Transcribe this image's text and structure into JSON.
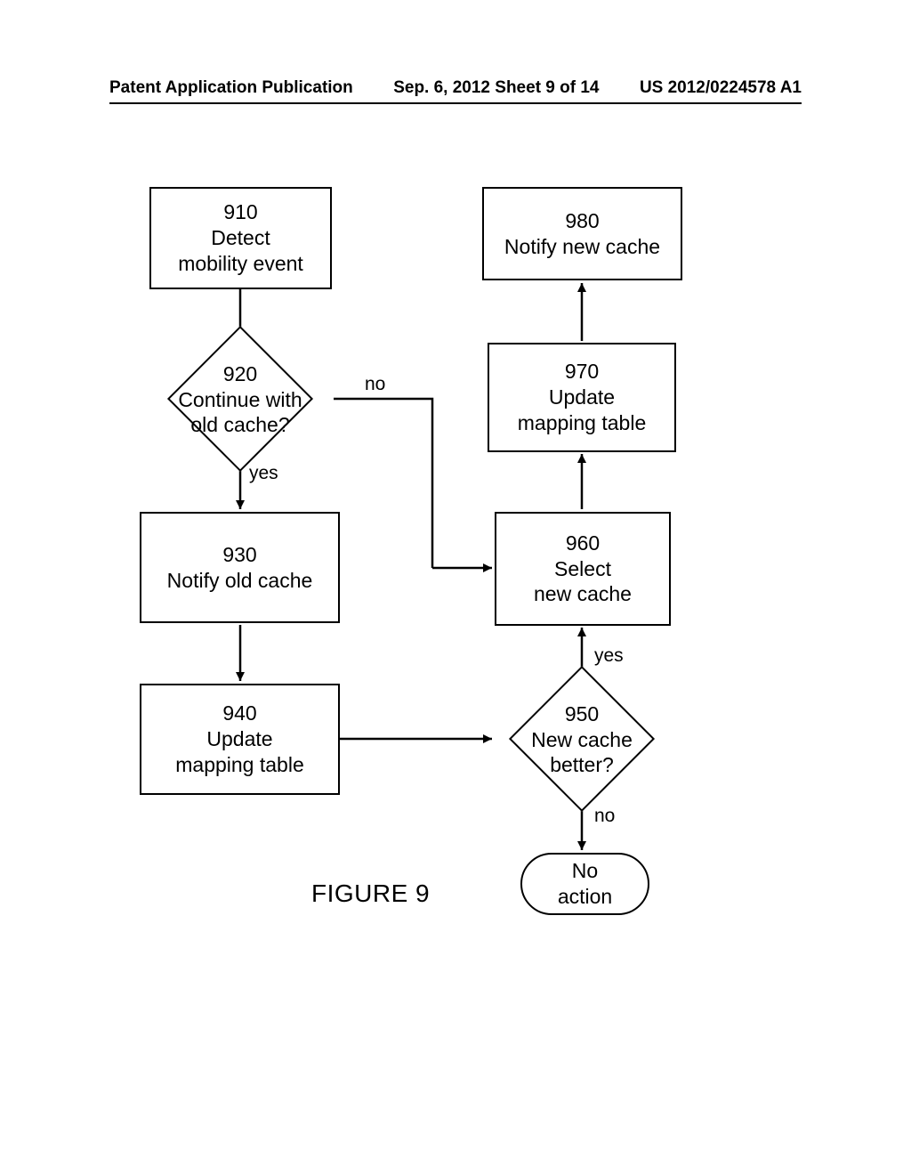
{
  "header": {
    "left": "Patent Application Publication",
    "center": "Sep. 6, 2012  Sheet 9 of 14",
    "right": "US 2012/0224578 A1"
  },
  "nodes": {
    "n910": {
      "num": "910",
      "text1": "Detect",
      "text2": "mobility event"
    },
    "n920": {
      "num": "920",
      "text1": "Continue with",
      "text2": "old cache?"
    },
    "n930": {
      "num": "930",
      "text1": "Notify old cache"
    },
    "n940": {
      "num": "940",
      "text1": "Update",
      "text2": "mapping table"
    },
    "n950": {
      "num": "950",
      "text1": "New cache",
      "text2": "better?"
    },
    "n960": {
      "num": "960",
      "text1": "Select",
      "text2": "new cache"
    },
    "n970": {
      "num": "970",
      "text1": "Update",
      "text2": "mapping table"
    },
    "n980": {
      "num": "980",
      "text1": "Notify new cache"
    },
    "terminal": {
      "text1": "No",
      "text2": "action"
    }
  },
  "edges": {
    "no": "no",
    "yes1": "yes",
    "yes2": "yes",
    "no2": "no"
  },
  "figure": "FIGURE 9",
  "chart_data": {
    "type": "flowchart",
    "nodes": [
      {
        "id": "910",
        "type": "process",
        "label": "Detect mobility event"
      },
      {
        "id": "920",
        "type": "decision",
        "label": "Continue with old cache?"
      },
      {
        "id": "930",
        "type": "process",
        "label": "Notify old cache"
      },
      {
        "id": "940",
        "type": "process",
        "label": "Update mapping table"
      },
      {
        "id": "950",
        "type": "decision",
        "label": "New cache better?"
      },
      {
        "id": "960",
        "type": "process",
        "label": "Select new cache"
      },
      {
        "id": "970",
        "type": "process",
        "label": "Update mapping table"
      },
      {
        "id": "980",
        "type": "process",
        "label": "Notify new cache"
      },
      {
        "id": "end",
        "type": "terminal",
        "label": "No action"
      }
    ],
    "edges": [
      {
        "from": "910",
        "to": "920"
      },
      {
        "from": "920",
        "to": "930",
        "label": "yes"
      },
      {
        "from": "920",
        "to": "960",
        "label": "no"
      },
      {
        "from": "930",
        "to": "940"
      },
      {
        "from": "940",
        "to": "950"
      },
      {
        "from": "950",
        "to": "960",
        "label": "yes"
      },
      {
        "from": "950",
        "to": "end",
        "label": "no"
      },
      {
        "from": "960",
        "to": "970"
      },
      {
        "from": "970",
        "to": "980"
      }
    ]
  }
}
